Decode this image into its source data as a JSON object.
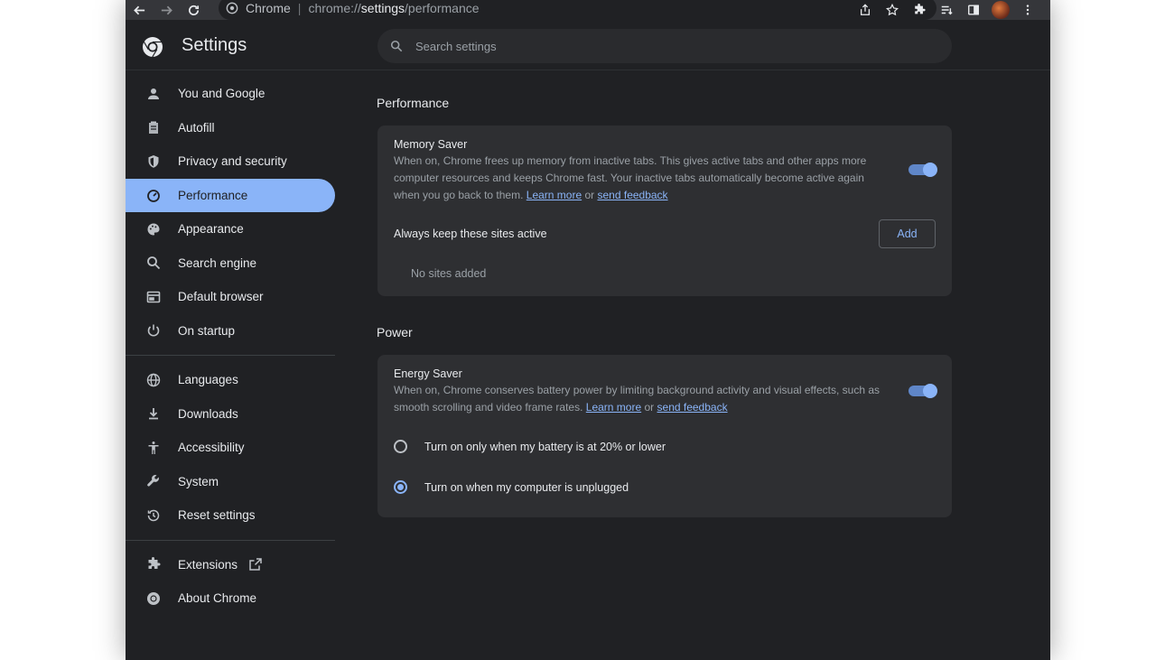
{
  "toolbar": {
    "back_icon": "back-arrow-icon",
    "forward_icon": "forward-arrow-icon",
    "reload_icon": "reload-icon",
    "site_name": "Chrome",
    "url_prefix": "chrome://",
    "url_host": "settings",
    "url_path": "/performance",
    "right_icons": [
      "share-icon",
      "star-icon",
      "extensions-icon",
      "reading-list-icon",
      "side-panel-icon",
      "avatar",
      "menu-icon"
    ]
  },
  "header": {
    "title": "Settings",
    "search_placeholder": "Search settings"
  },
  "sidebar": {
    "group1": [
      {
        "label": "You and Google",
        "icon": "person-icon"
      },
      {
        "label": "Autofill",
        "icon": "clipboard-icon"
      },
      {
        "label": "Privacy and security",
        "icon": "shield-icon"
      },
      {
        "label": "Performance",
        "icon": "speedometer-icon",
        "active": true
      },
      {
        "label": "Appearance",
        "icon": "palette-icon"
      },
      {
        "label": "Search engine",
        "icon": "search-icon"
      },
      {
        "label": "Default browser",
        "icon": "browser-icon"
      },
      {
        "label": "On startup",
        "icon": "power-icon"
      }
    ],
    "group2": [
      {
        "label": "Languages",
        "icon": "globe-icon"
      },
      {
        "label": "Downloads",
        "icon": "download-icon"
      },
      {
        "label": "Accessibility",
        "icon": "accessibility-icon"
      },
      {
        "label": "System",
        "icon": "wrench-icon"
      },
      {
        "label": "Reset settings",
        "icon": "history-icon"
      }
    ],
    "group3": [
      {
        "label": "Extensions",
        "icon": "puzzle-icon"
      },
      {
        "label": "About Chrome",
        "icon": "chrome-icon"
      }
    ]
  },
  "performance": {
    "section_title": "Performance",
    "memory_saver": {
      "title": "Memory Saver",
      "desc_line1": "When on, Chrome frees up memory from inactive tabs. This gives active tabs and other apps more",
      "desc_line2": "computer resources and keeps Chrome fast. Your inactive tabs automatically become active again",
      "desc_line3": "when you go back to them.",
      "learn_more": "Learn more",
      "or": "or",
      "send_feedback": "send feedback",
      "enabled": true
    },
    "keep_active": {
      "title": "Always keep these sites active",
      "add_label": "Add",
      "empty_text": "No sites added"
    }
  },
  "power": {
    "section_title": "Power",
    "energy_saver": {
      "title": "Energy Saver",
      "desc_line1": "When on, Chrome conserves battery power by limiting background activity and visual effects, such as",
      "desc_line2": "smooth scrolling and video frame rates.",
      "learn_more": "Learn more",
      "or": "or",
      "send_feedback": "send feedback",
      "enabled": true
    },
    "options": [
      {
        "label": "Turn on only when my battery is at 20% or lower",
        "checked": false
      },
      {
        "label": "Turn on when my computer is unplugged",
        "checked": true
      }
    ]
  },
  "colors": {
    "accent": "#8ab4f8",
    "background": "#202124",
    "card": "#2e2f32"
  }
}
